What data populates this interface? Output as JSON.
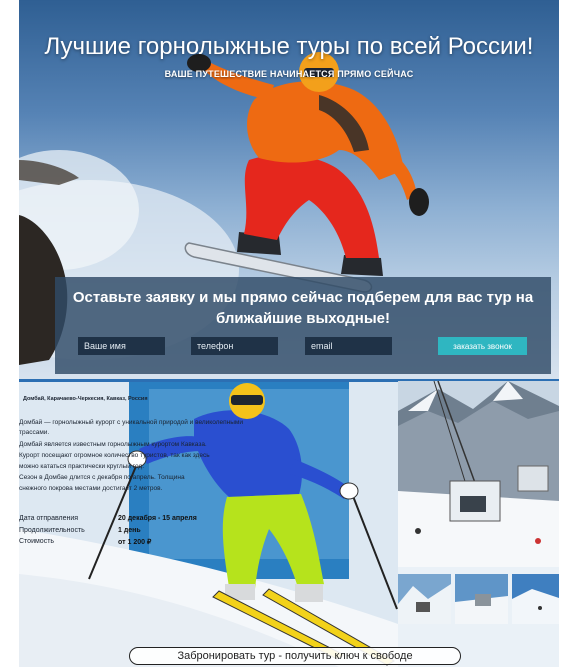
{
  "hero": {
    "title": "Лучшие горнолыжные туры по всей России!",
    "subtitle": "ВАШЕ ПУТЕШЕСТВИЕ НАЧИНАЕТСЯ ПРЯМО СЕЙЧАС"
  },
  "form": {
    "title_line1": "Оставьте заявку и мы прямо сейчас подберем для вас тур на",
    "title_line2": "ближайшие выходные!",
    "name_placeholder": "Ваше имя",
    "phone_placeholder": "телефон",
    "email_placeholder": "email",
    "submit_label": "заказать звонок"
  },
  "tour": {
    "location": "Домбай, Карачаево-Черкесия, Кавказ, Россия",
    "description_lines": [
      "Домбай — горнолыжный курорт с уникальной природой и великолепными",
      "трассами.",
      "Домбай является известным горнолыжным курортом Кавказа.",
      "Курорт посещают огромное количество туристов, так как здесь",
      "можно кататься практически круглый год.",
      "Сезон в Домбае длится с декабря по апрель. Толщина",
      "снежного покрова местами достигает 2 метров."
    ],
    "details": [
      {
        "label": "Дата отправления",
        "value": "20 декабря - 15 апреля"
      },
      {
        "label": "Продолжительность",
        "value": "1 день"
      },
      {
        "label": "Стоимость",
        "value": "от 1 200 ₽"
      }
    ],
    "book_label": "Забронировать тур - получить ключ к свободе"
  },
  "colors": {
    "accent": "#2fb6c1",
    "panel": "#304a66",
    "input_bg": "#1f3247",
    "jacket_orange": "#ee6a12",
    "jacket_blue": "#2a4fd0",
    "pants_yellow": "#b6e31c",
    "pants_red": "#e5271d"
  },
  "icons": [
    "snowboarder-photo",
    "skier-photo",
    "ski-lift-photo",
    "mountain-thumb-photo"
  ]
}
